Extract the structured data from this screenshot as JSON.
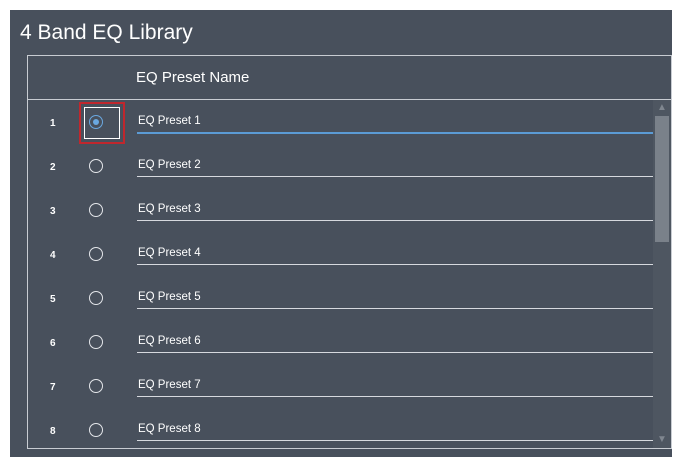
{
  "window": {
    "title": "4 Band EQ Library"
  },
  "list": {
    "header_label": "EQ Preset Name",
    "rows": [
      {
        "number": "1",
        "name": "EQ Preset 1",
        "selected": true
      },
      {
        "number": "2",
        "name": "EQ Preset 2",
        "selected": false
      },
      {
        "number": "3",
        "name": "EQ Preset 3",
        "selected": false
      },
      {
        "number": "4",
        "name": "EQ Preset 4",
        "selected": false
      },
      {
        "number": "5",
        "name": "EQ Preset 5",
        "selected": false
      },
      {
        "number": "6",
        "name": "EQ Preset 6",
        "selected": false
      },
      {
        "number": "7",
        "name": "EQ Preset 7",
        "selected": false
      },
      {
        "number": "8",
        "name": "EQ Preset 8",
        "selected": false
      }
    ]
  },
  "scrollbar": {
    "up_icon": "arrow-up-icon",
    "down_icon": "arrow-down-icon"
  },
  "colors": {
    "background": "#48505c",
    "accent": "#5b9bd5",
    "focus_outline": "#c0272d"
  }
}
